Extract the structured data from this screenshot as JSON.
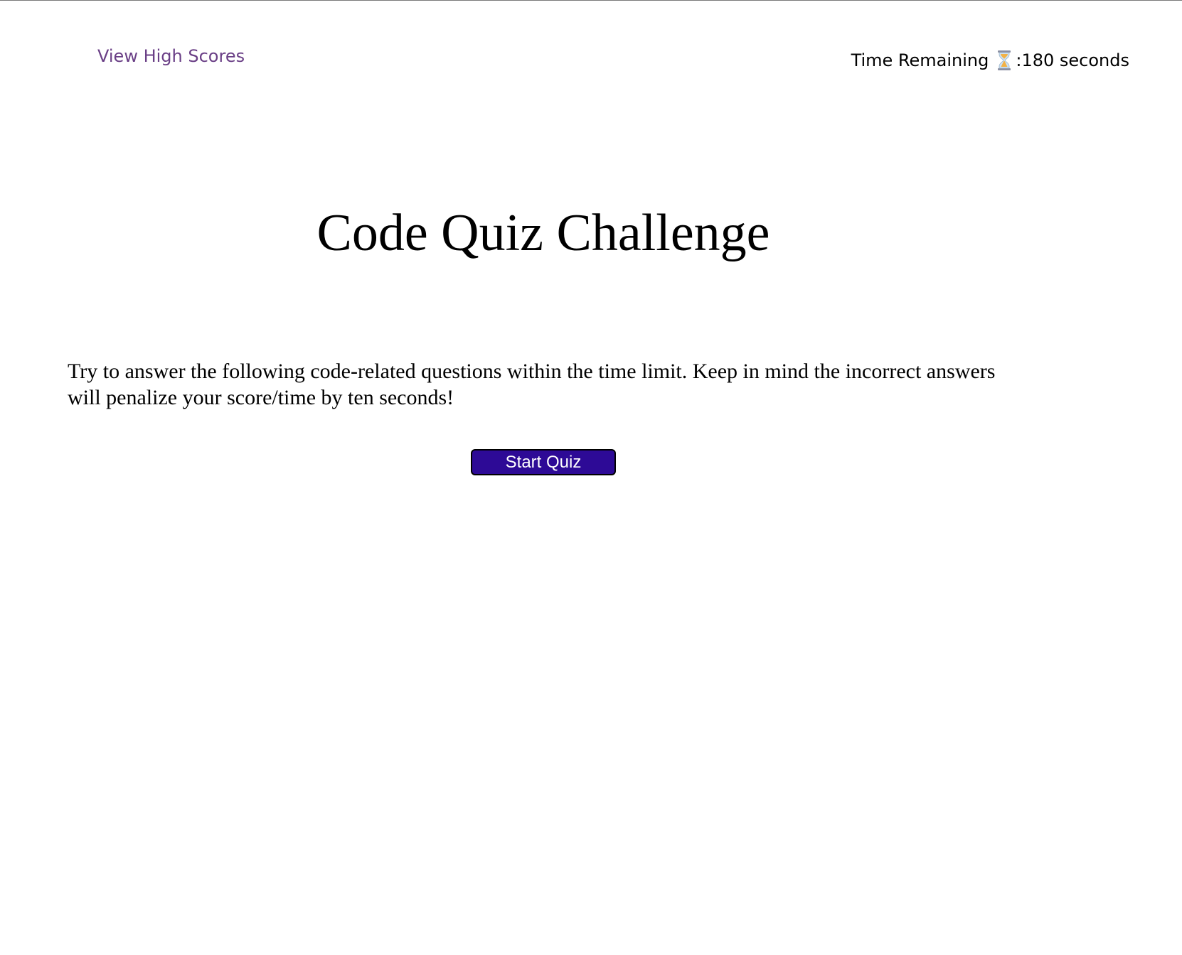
{
  "header": {
    "high_scores_label": "View High Scores",
    "timer_label": "Time Remaining",
    "timer_icon": "hourglass-icon",
    "timer_value": ":180 seconds"
  },
  "main": {
    "title": "Code Quiz Challenge",
    "intro": "Try to answer the following code-related questions within the time limit. Keep in mind the incorrect answers will penalize your score/time by ten seconds!",
    "start_button_label": "Start Quiz"
  },
  "colors": {
    "link": "#6a3f86",
    "button_bg": "#2d0a96",
    "button_text": "#ffffff"
  }
}
